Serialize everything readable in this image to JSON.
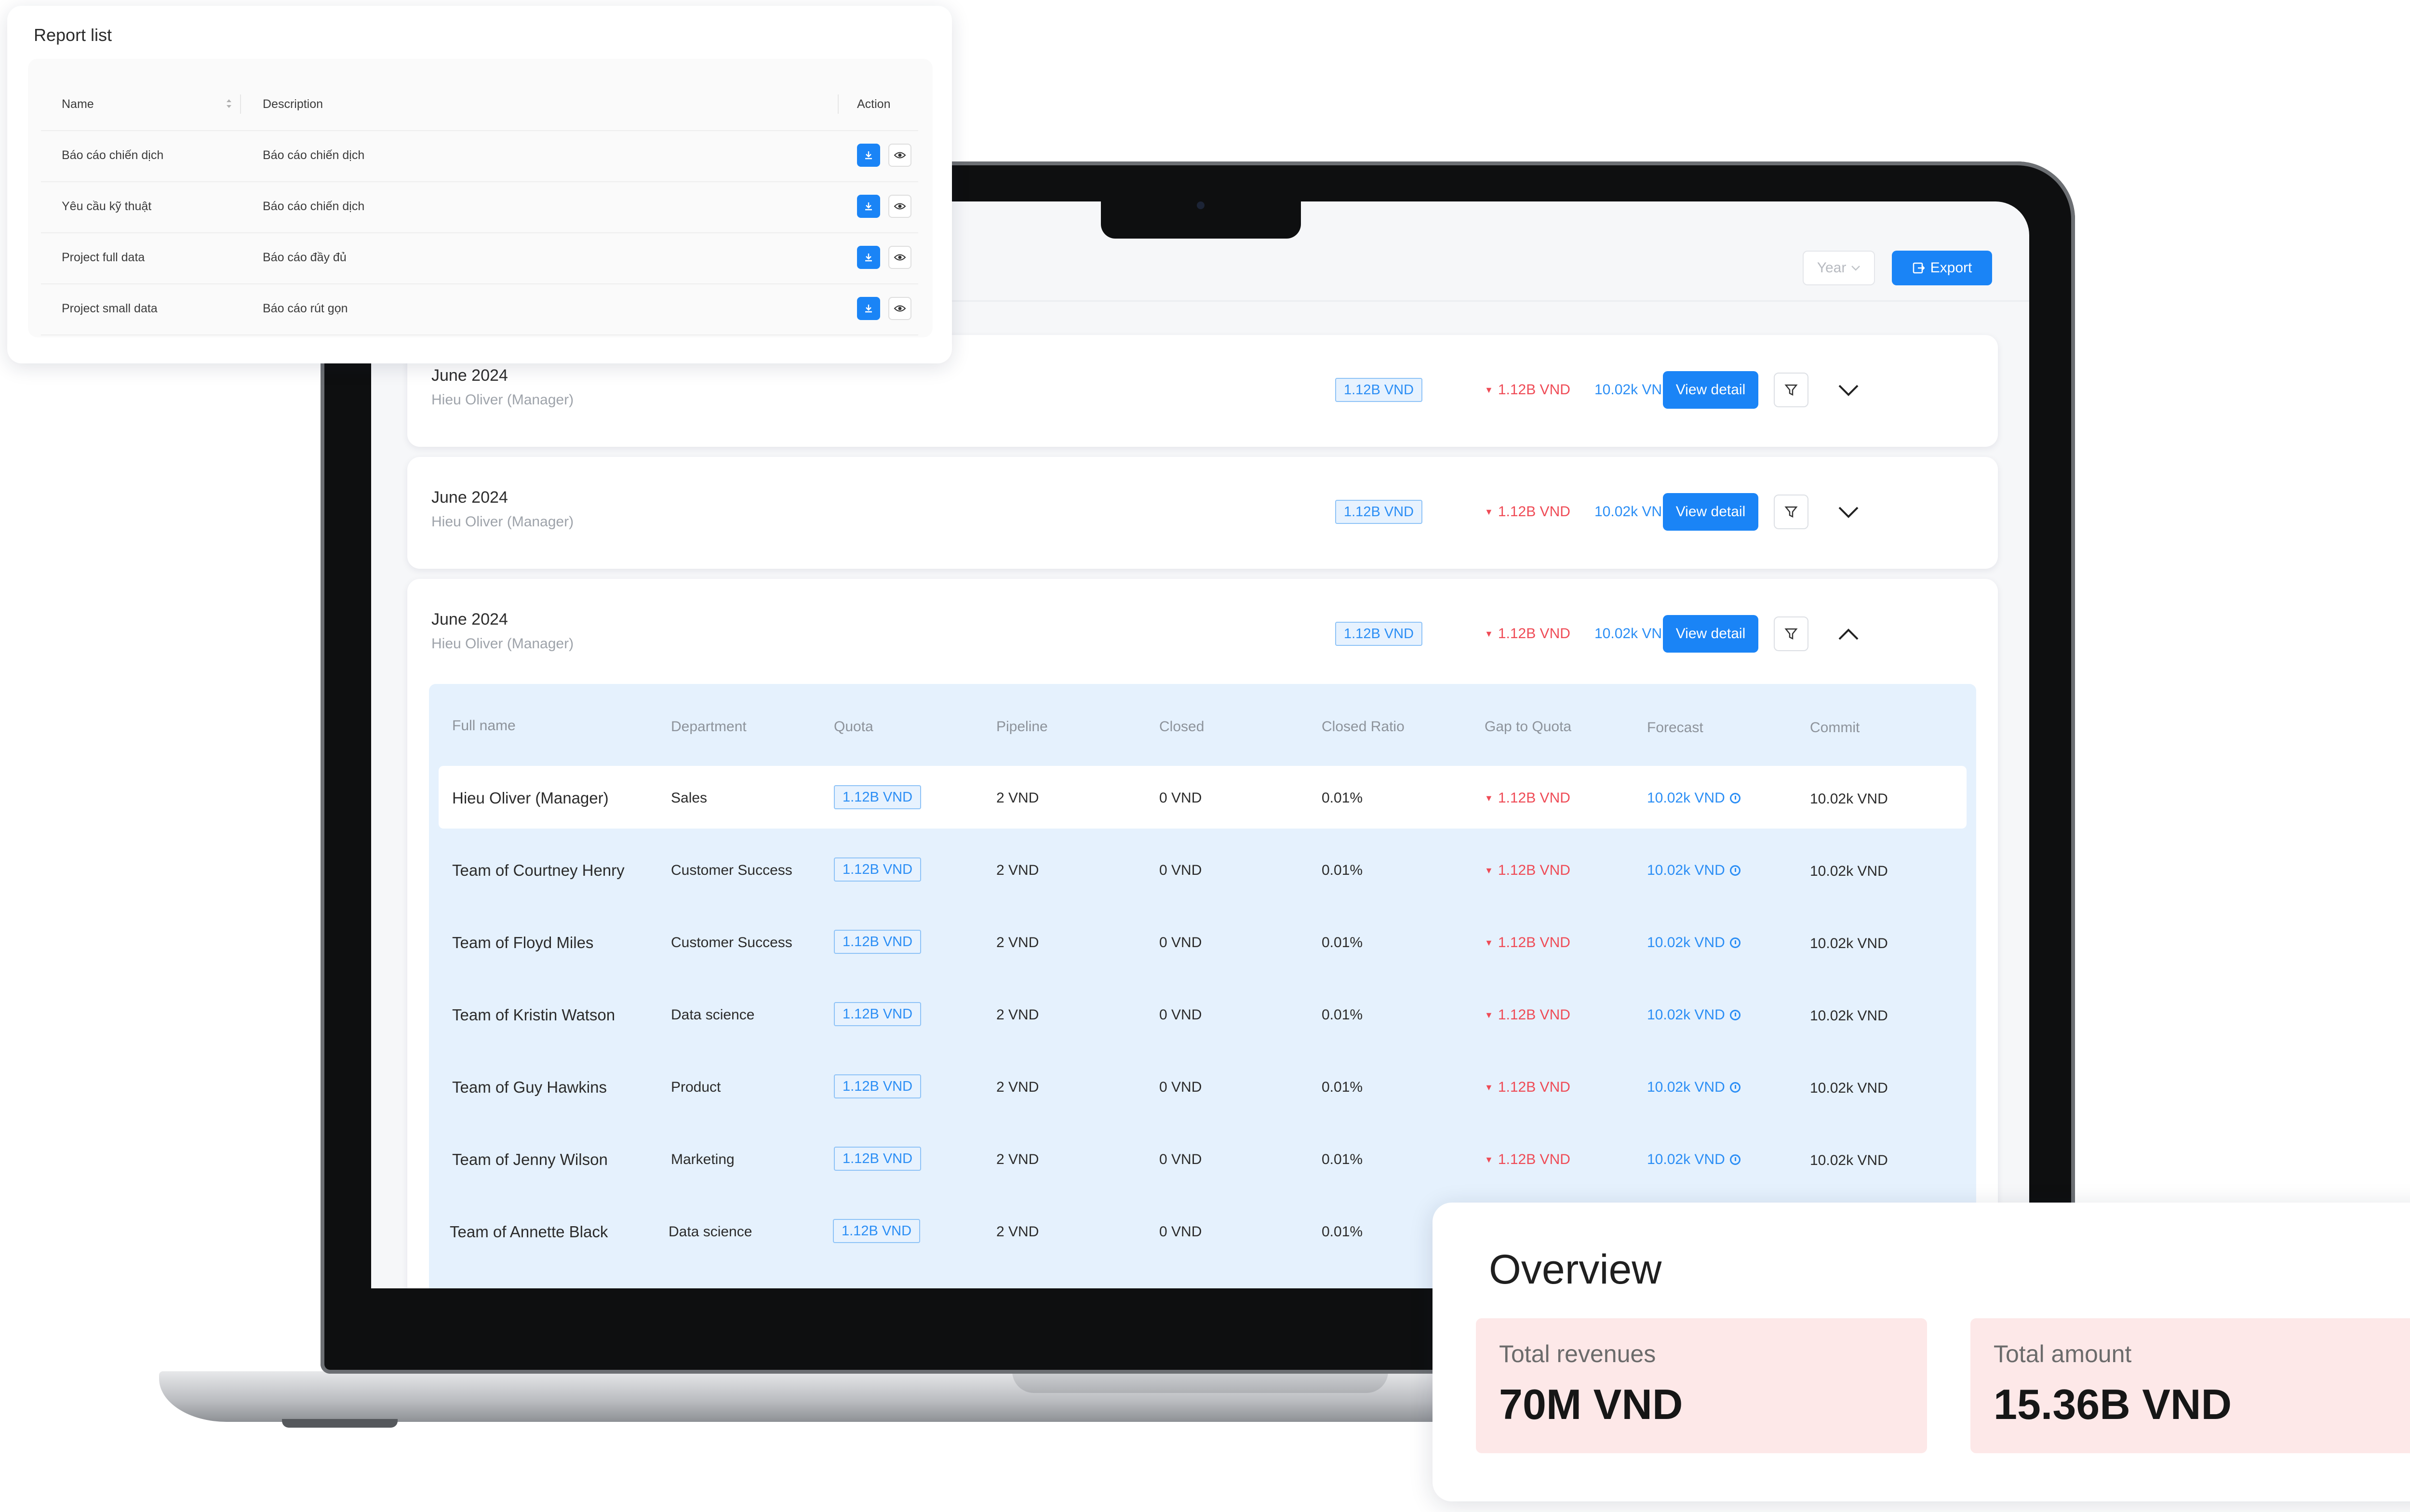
{
  "report_list": {
    "title": "Report list",
    "columns": {
      "name": "Name",
      "description": "Description",
      "action": "Action"
    },
    "rows": [
      {
        "name": "Báo cáo chiến dịch",
        "description": "Báo cáo chiến dịch"
      },
      {
        "name": "Yêu cầu kỹ thuật",
        "description": "Báo cáo chiến dịch"
      },
      {
        "name": "Project full data",
        "description": "Báo cáo đầy đủ"
      },
      {
        "name": "Project small data",
        "description": "Báo cáo rút gọn"
      }
    ]
  },
  "toolbar": {
    "year_label": "Year",
    "export_label": "Export"
  },
  "cards": [
    {
      "title": "June 2024",
      "manager": "Hieu Oliver (Manager)",
      "quota": "1.12B VND",
      "gap": "1.12B VND",
      "forecast": "10.02k VND",
      "view_label": "View detail",
      "expanded": false
    },
    {
      "title": "June 2024",
      "manager": "Hieu Oliver (Manager)",
      "quota": "1.12B VND",
      "gap": "1.12B VND",
      "forecast": "10.02k VND",
      "view_label": "View detail",
      "expanded": false
    },
    {
      "title": "June 2024",
      "manager": "Hieu Oliver (Manager)",
      "quota": "1.12B VND",
      "gap": "1.12B VND",
      "forecast": "10.02k VND",
      "view_label": "View detail",
      "expanded": true
    }
  ],
  "detail_table": {
    "columns": [
      "Full name",
      "Department",
      "Quota",
      "Pipeline",
      "Closed",
      "Closed Ratio",
      "Gap to Quota",
      "Forecast",
      "Commit"
    ],
    "rows": [
      {
        "name": "Hieu Oliver (Manager)",
        "department": "Sales",
        "quota": "1.12B VND",
        "pipeline": "2 VND",
        "closed": "0 VND",
        "ratio": "0.01%",
        "gap": "1.12B VND",
        "forecast": "10.02k VND",
        "commit": "10.02k VND"
      },
      {
        "name": "Team of Courtney Henry",
        "department": "Customer Success",
        "quota": "1.12B VND",
        "pipeline": "2 VND",
        "closed": "0 VND",
        "ratio": "0.01%",
        "gap": "1.12B VND",
        "forecast": "10.02k VND",
        "commit": "10.02k VND"
      },
      {
        "name": "Team of Floyd Miles",
        "department": "Customer Success",
        "quota": "1.12B VND",
        "pipeline": "2 VND",
        "closed": "0 VND",
        "ratio": "0.01%",
        "gap": "1.12B VND",
        "forecast": "10.02k VND",
        "commit": "10.02k VND"
      },
      {
        "name": "Team of Kristin Watson",
        "department": "Data science",
        "quota": "1.12B VND",
        "pipeline": "2 VND",
        "closed": "0 VND",
        "ratio": "0.01%",
        "gap": "1.12B VND",
        "forecast": "10.02k VND",
        "commit": "10.02k VND"
      },
      {
        "name": "Team of Guy Hawkins",
        "department": "Product",
        "quota": "1.12B VND",
        "pipeline": "2 VND",
        "closed": "0 VND",
        "ratio": "0.01%",
        "gap": "1.12B VND",
        "forecast": "10.02k VND",
        "commit": "10.02k VND"
      },
      {
        "name": "Team of Jenny Wilson",
        "department": "Marketing",
        "quota": "1.12B VND",
        "pipeline": "2 VND",
        "closed": "0 VND",
        "ratio": "0.01%",
        "gap": "1.12B VND",
        "forecast": "10.02k VND",
        "commit": "10.02k VND"
      },
      {
        "name": "Team of Annette Black",
        "department": "Data science",
        "quota": "1.12B VND",
        "pipeline": "2 VND",
        "closed": "0 VND",
        "ratio": "0.01%",
        "gap": "",
        "forecast": "",
        "commit": ""
      }
    ]
  },
  "overview": {
    "title": "Overview",
    "total_revenues_label": "Total revenues",
    "total_revenues_value": "70M VND",
    "total_amount_label": "Total amount",
    "total_amount_value": "15.36B VND"
  },
  "colors": {
    "primary": "#1a84f6",
    "negative": "#ef4b56",
    "tag_bg": "#e7f2fe",
    "table_bg": "#e5f1fd",
    "overview_box": "#fde8e8"
  },
  "icons": {
    "download": "download-icon",
    "view": "eye-icon",
    "filter": "funnel-icon",
    "expand": "chevron-down-icon",
    "collapse": "chevron-up-icon",
    "forecast": "clock-icon",
    "export": "export-icon",
    "sort": "sort-icon"
  }
}
